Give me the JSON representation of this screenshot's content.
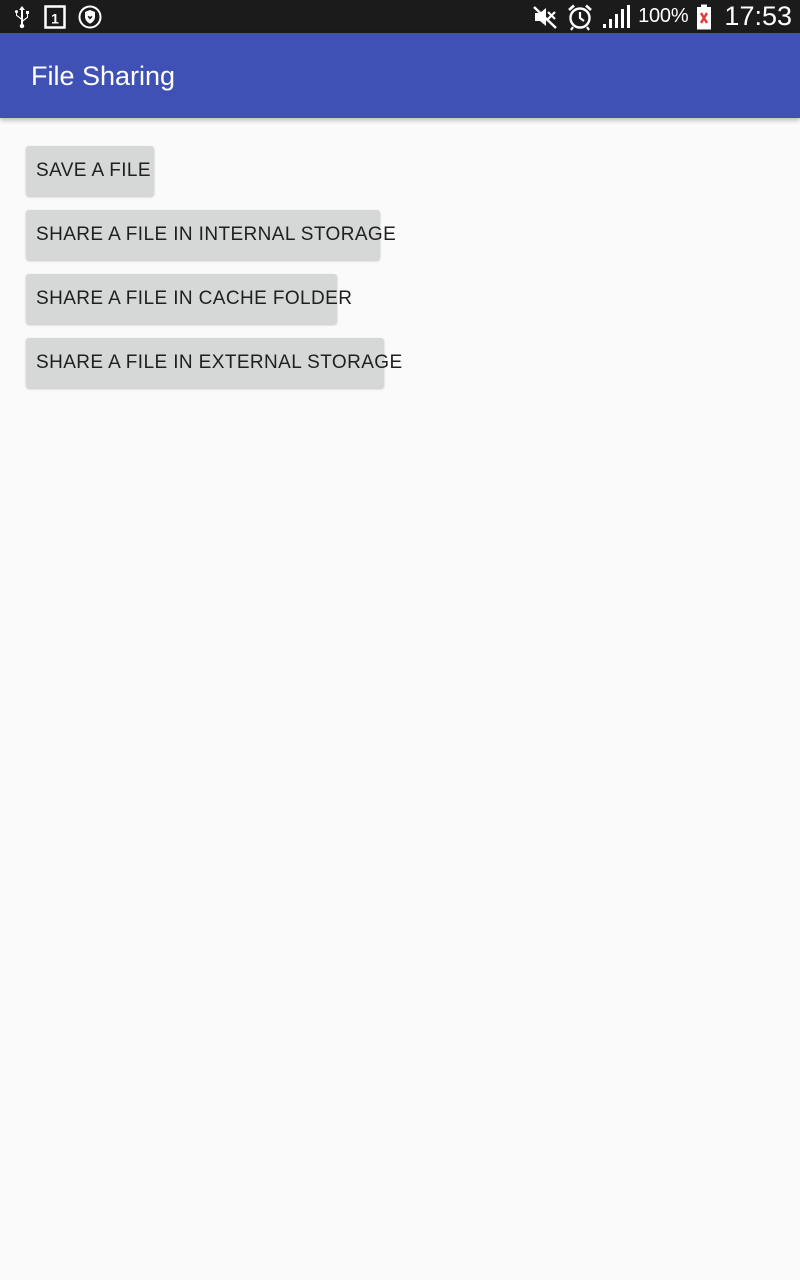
{
  "status_bar": {
    "left_icons": [
      "usb-icon",
      "sim-card-icon",
      "shield-icon"
    ],
    "right_icons": [
      "mute-icon",
      "alarm-icon",
      "signal-icon",
      "battery-icon"
    ],
    "battery_percent": "100%",
    "time": "17:53"
  },
  "app_bar": {
    "title": "File Sharing",
    "color": "#3F51B5"
  },
  "buttons": [
    {
      "label": "SAVE A FILE"
    },
    {
      "label": "SHARE A FILE IN INTERNAL STORAGE"
    },
    {
      "label": "SHARE A FILE IN CACHE FOLDER"
    },
    {
      "label": "SHARE A FILE IN EXTERNAL STORAGE"
    }
  ],
  "sim_slot": "1"
}
